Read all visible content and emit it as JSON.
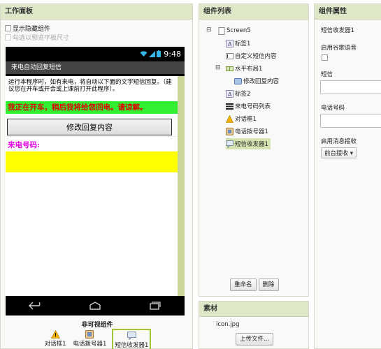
{
  "viewer": {
    "title": "工作面板",
    "show_hidden_label": "显示隐藏组件",
    "tablet_preview_label": "勾选以预览平板尺寸",
    "status_time": "9:48",
    "app_title": "来电自动回复短信",
    "label1_text": "运行本程序时，如有来电，将自动以下面的文字短信回复。（建议您在开车或开会或上课前打开此程序）。",
    "sms_text": "我正在开车，稍后我将给您回电。请谅解。",
    "modify_button": "修改回复内容",
    "label2_text": "来电号码:",
    "nonvisible_title": "非可视组件",
    "nonvisible": [
      {
        "label": "对话框1",
        "icon": "warning-icon"
      },
      {
        "label": "电话拨号器1",
        "icon": "phone-dialer-icon"
      },
      {
        "label": "短信收发器1",
        "icon": "texting-icon",
        "selected": true
      }
    ],
    "colors": {
      "green": "#33ee33",
      "red_text": "#e00000",
      "magenta": "#e000e0",
      "yellow": "#ffff00"
    }
  },
  "components": {
    "title": "组件列表",
    "tree": [
      {
        "label": "Screen5",
        "icon": "screen-icon"
      },
      {
        "label": "标签1",
        "icon": "label-icon"
      },
      {
        "label": "自定义短信内容",
        "icon": "textbox-icon"
      },
      {
        "label": "水平布局1",
        "icon": "hlayout-icon"
      },
      {
        "label": "修改回复内容",
        "icon": "button-icon"
      },
      {
        "label": "标签2",
        "icon": "label-icon"
      },
      {
        "label": "来电号码列表",
        "icon": "listview-icon"
      },
      {
        "label": "对话框1",
        "icon": "warning-icon"
      },
      {
        "label": "电话拨号器1",
        "icon": "phone-dialer-icon"
      },
      {
        "label": "短信收发器1",
        "icon": "texting-icon"
      }
    ],
    "rename_button": "重命名",
    "delete_button": "删除"
  },
  "media": {
    "title": "素材",
    "file": "icon.jpg",
    "upload_button": "上传文件..."
  },
  "properties": {
    "title": "组件属性",
    "component_name": "短信收发器1",
    "google_voice_label": "启用谷歌语音",
    "message_label": "短信",
    "phone_label": "电话号码",
    "receiving_label": "启用消息接收",
    "receiving_value": "前台接收"
  }
}
